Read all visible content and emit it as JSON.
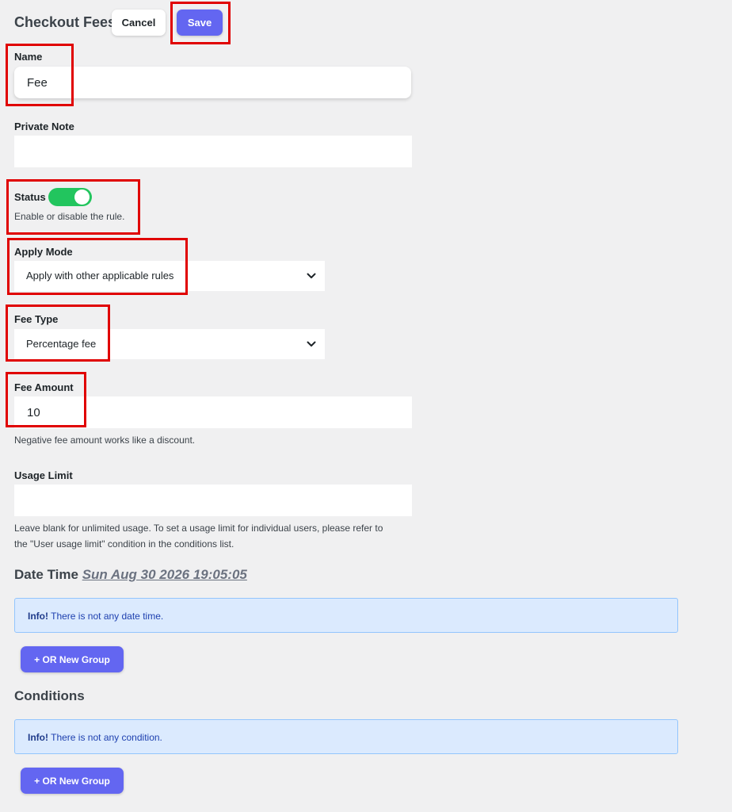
{
  "header": {
    "title": "Checkout Fees",
    "cancel_label": "Cancel",
    "save_label": "Save"
  },
  "form": {
    "name": {
      "label": "Name",
      "value": "Fee"
    },
    "private_note": {
      "label": "Private Note",
      "value": ""
    },
    "status": {
      "label": "Status",
      "enabled": true,
      "help": "Enable or disable the rule."
    },
    "apply_mode": {
      "label": "Apply Mode",
      "selected": "Apply with other applicable rules"
    },
    "fee_type": {
      "label": "Fee Type",
      "selected": "Percentage fee"
    },
    "fee_amount": {
      "label": "Fee Amount",
      "value": "10",
      "help": "Negative fee amount works like a discount."
    },
    "usage_limit": {
      "label": "Usage Limit",
      "value": "",
      "help_line1": "Leave blank for unlimited usage. To set a usage limit for individual users, please refer to",
      "help_line2": "the \"User usage limit\" condition in the conditions list."
    }
  },
  "date_time": {
    "heading": "Date Time",
    "value": "Sun Aug 30 2026 19:05:05",
    "info_bold": "Info!",
    "info_text": "There is not any date time.",
    "add_group_label": "+ OR New Group"
  },
  "conditions": {
    "heading": "Conditions",
    "info_bold": "Info!",
    "info_text": "There is not any condition.",
    "add_group_label": "+ OR New Group"
  },
  "colors": {
    "accent": "#6366f1",
    "toggle_on": "#22c55e",
    "highlight": "#e00000",
    "info_bg": "#dbeafe"
  },
  "icons": {
    "select_chevron": "chevron-down-icon",
    "toggle_knob": "toggle-knob"
  }
}
